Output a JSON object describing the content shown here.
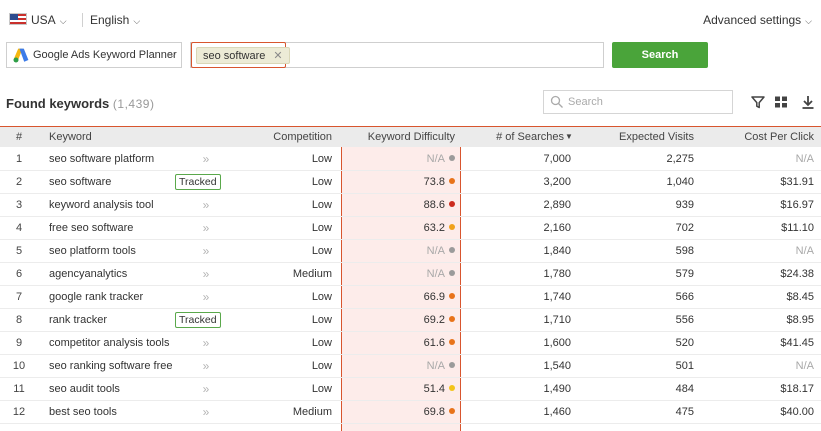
{
  "location": {
    "country": "USA",
    "language": "English",
    "advanced_settings": "Advanced settings"
  },
  "source": {
    "label": "Google Ads Keyword Planner"
  },
  "query": {
    "chip": "seo software",
    "search_button": "Search"
  },
  "results": {
    "title": "Found keywords",
    "count": "(1,439)",
    "search_placeholder": "Search"
  },
  "columns": {
    "num": "#",
    "keyword": "Keyword",
    "competition": "Competition",
    "difficulty": "Keyword Difficulty",
    "searches": "# of Searches",
    "visits": "Expected Visits",
    "cpc": "Cost Per Click"
  },
  "tracked_label": "Tracked",
  "rows": [
    {
      "num": "1",
      "keyword": "seo software platform",
      "tracked": false,
      "competition": "Low",
      "difficulty": "N/A",
      "dot": "#9b9b9b",
      "searches": "7,000",
      "visits": "2,275",
      "cpc": "N/A"
    },
    {
      "num": "2",
      "keyword": "seo software",
      "tracked": true,
      "competition": "Low",
      "difficulty": "73.8",
      "dot": "#e8731a",
      "searches": "3,200",
      "visits": "1,040",
      "cpc": "$31.91"
    },
    {
      "num": "3",
      "keyword": "keyword analysis tool",
      "tracked": false,
      "competition": "Low",
      "difficulty": "88.6",
      "dot": "#cc2a1e",
      "searches": "2,890",
      "visits": "939",
      "cpc": "$16.97"
    },
    {
      "num": "4",
      "keyword": "free seo software",
      "tracked": false,
      "competition": "Low",
      "difficulty": "63.2",
      "dot": "#f0a21c",
      "searches": "2,160",
      "visits": "702",
      "cpc": "$11.10"
    },
    {
      "num": "5",
      "keyword": "seo platform tools",
      "tracked": false,
      "competition": "Low",
      "difficulty": "N/A",
      "dot": "#9b9b9b",
      "searches": "1,840",
      "visits": "598",
      "cpc": "N/A"
    },
    {
      "num": "6",
      "keyword": "agencyanalytics",
      "tracked": false,
      "competition": "Medium",
      "difficulty": "N/A",
      "dot": "#9b9b9b",
      "searches": "1,780",
      "visits": "579",
      "cpc": "$24.38"
    },
    {
      "num": "7",
      "keyword": "google rank tracker",
      "tracked": false,
      "competition": "Low",
      "difficulty": "66.9",
      "dot": "#e8731a",
      "searches": "1,740",
      "visits": "566",
      "cpc": "$8.45"
    },
    {
      "num": "8",
      "keyword": "rank tracker",
      "tracked": true,
      "competition": "Low",
      "difficulty": "69.2",
      "dot": "#e8731a",
      "searches": "1,710",
      "visits": "556",
      "cpc": "$8.95"
    },
    {
      "num": "9",
      "keyword": "competitor analysis tools",
      "tracked": false,
      "competition": "Low",
      "difficulty": "61.6",
      "dot": "#e8731a",
      "searches": "1,600",
      "visits": "520",
      "cpc": "$41.45"
    },
    {
      "num": "10",
      "keyword": "seo ranking software free",
      "tracked": false,
      "competition": "Low",
      "difficulty": "N/A",
      "dot": "#9b9b9b",
      "searches": "1,540",
      "visits": "501",
      "cpc": "N/A"
    },
    {
      "num": "11",
      "keyword": "seo audit tools",
      "tracked": false,
      "competition": "Low",
      "difficulty": "51.4",
      "dot": "#f3c419",
      "searches": "1,490",
      "visits": "484",
      "cpc": "$18.17"
    },
    {
      "num": "12",
      "keyword": "best seo tools",
      "tracked": false,
      "competition": "Medium",
      "difficulty": "69.8",
      "dot": "#e8731a",
      "searches": "1,460",
      "visits": "475",
      "cpc": "$40.00"
    }
  ],
  "icons": {
    "filter": "filter-icon",
    "view": "grid-view-icon",
    "download": "download-icon",
    "search": "search-icon",
    "row_arrow": "double-chevron-right-icon",
    "sort": "sort-desc-icon"
  },
  "colors": {
    "accent": "#d8552e",
    "search_button": "#4aa43a",
    "tracked_border": "#5aa84b",
    "difficulty_bg": "#fdecea"
  }
}
